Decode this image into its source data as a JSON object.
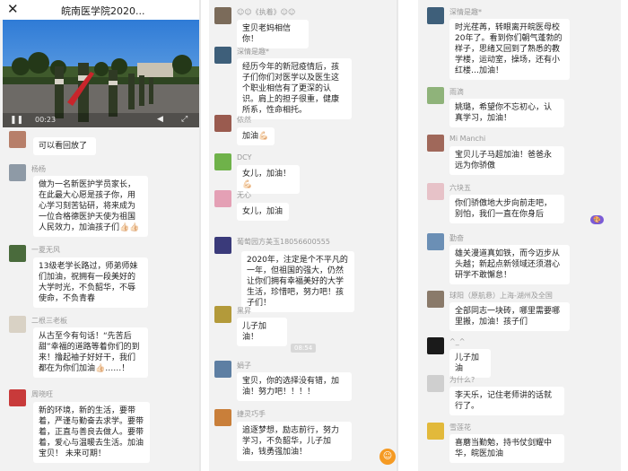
{
  "header": {
    "title": "皖南医学院2020...",
    "close_icon": "close-icon"
  },
  "video": {
    "time": "00:23",
    "play_icon": "pause-icon",
    "volume_icon": "volume-icon",
    "fullscreen_icon": "fullscreen-icon"
  },
  "col1": [
    {
      "name": "",
      "text": "可以看回放了"
    },
    {
      "name": "杨杨",
      "text": "做为一名新医护学员家长，在此最大心愿是孩子你，用心学习刻苦钻研，将来成为一位合格德医护天使为祖国人民效力，加油孩子们👍🏻👍🏻"
    },
    {
      "name": "一夏无风",
      "text": "13级老学长路过，师弟师妹们加油，祝拥有一段美好的大学时光，不负韶华，不辱使命，不负青春"
    },
    {
      "name": "二根三老板",
      "text": "从古至今有句话！“先苦后甜”幸福的道路等着你们的到来！撸起袖子好好干，我们都在为你们加油👍🏻……！"
    },
    {
      "name": "周晓旺",
      "text": "新的环境，新的生活，要带着，严谨与勤奋去求学。要带着，正直与善良去做人。要带着，爱心与温暖去生活。加油宝贝！ 未来可期！"
    }
  ],
  "col2": [
    {
      "name": "☺☺《执着》☺☺",
      "text": "宝贝老妈相信你！"
    },
    {
      "name": "深情是趣*",
      "text": "经历今年的新冠疫情后，孩子们你们对医学以及医生这个职业相信有了更深的认识。肩上的担子很重，健康所系，性命相托。"
    },
    {
      "name": "侬然",
      "text": "加油💪🏻"
    },
    {
      "name": "DCY",
      "text": "女儿，加油！💪🏻"
    },
    {
      "name": "无心",
      "text": "女儿，加油"
    },
    {
      "name": "葡萄园方美玉18056600555",
      "text": "2020年，注定是个不平凡的一年，但祖国的强大，仍然让你们拥有幸福美好的大学生活，珍惜吧，努力吧！孩子们！"
    },
    {
      "name": "黑昇",
      "text": "儿子加油！"
    },
    {
      "name": "娟子",
      "text": "宝贝，你的选择没有错，加油！努力吧！！！！"
    },
    {
      "name": "捷灵巧手",
      "text": "追逐梦想，励志前行，努力学习，不负韶华，儿子加油，钱勇强加油！"
    }
  ],
  "col2_time": "08:54",
  "col3": [
    {
      "name": "深情是趣*",
      "text": "时光荏苒，转眼离开皖医母校20年了。看到你们朝气蓬勃的样子，思绪又回到了熟悉的教学楼，运动室，操场，还有小红楼…加油！"
    },
    {
      "name": "雨滴",
      "text": "姚璐，希望你不忘初心，认真学习，加油！"
    },
    {
      "name": "Mi Manchi",
      "text": "宝贝儿子马超加油！爸爸永远为你骄傲"
    },
    {
      "name": "六块五",
      "text": "你们骄傲地大步向前走吧，别怕，我们一直在你身后"
    },
    {
      "name": "勤奋",
      "text": "雄关漫道真如铁，而今迈步从头越；新起点新领域还须潜心研学不敢懈怠！"
    },
    {
      "name": "球阳（原航悬）上海-湖州及全国",
      "text": "全部同志一块砖，哪里需要哪里搬，加油！孩子们"
    },
    {
      "name": "^_^",
      "text": "儿子加油"
    },
    {
      "name": "为什么?",
      "text": "李天乐，记住老师讲的话就行了。"
    },
    {
      "name": "雪莲花",
      "text": "喜蘑当勤勉，持书仗剑耀中华，皖医加油"
    }
  ],
  "fab_icon": "emoji-icon",
  "badge": "🎨"
}
